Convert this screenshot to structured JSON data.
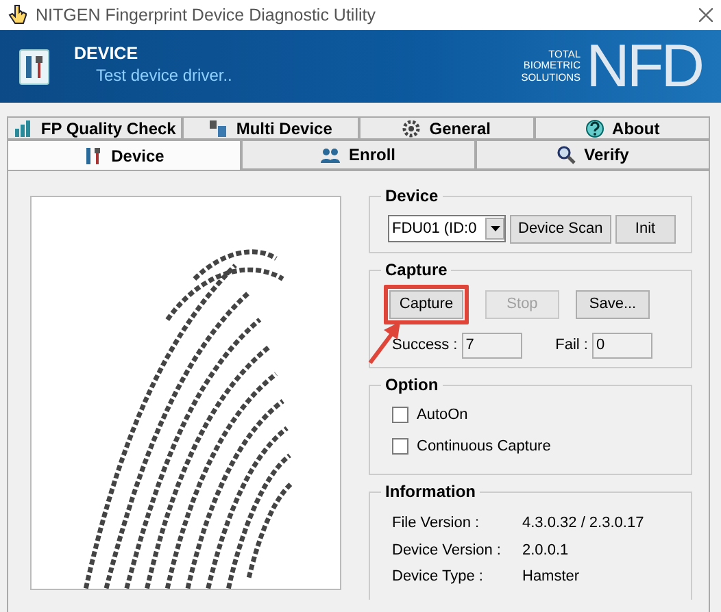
{
  "window": {
    "title": "NITGEN Fingerprint Device Diagnostic Utility"
  },
  "banner": {
    "title": "DEVICE",
    "subtitle": "Test device driver..",
    "tagline": [
      "TOTAL",
      "BIOMETRIC",
      "SOLUTIONS"
    ],
    "logo": "NFD"
  },
  "tabs_back_row": [
    {
      "label": "FP Quality Check",
      "kind": "chart",
      "selected": false
    },
    {
      "label": "Multi Device",
      "kind": "devices",
      "selected": false
    },
    {
      "label": "General",
      "kind": "gear",
      "selected": false
    },
    {
      "label": "About",
      "kind": "help",
      "selected": false
    }
  ],
  "tabs_front_row": [
    {
      "label": "Device",
      "kind": "tools",
      "selected": true
    },
    {
      "label": "Enroll",
      "kind": "people",
      "selected": false
    },
    {
      "label": "Verify",
      "kind": "search",
      "selected": false
    }
  ],
  "device_group": {
    "title": "Device",
    "device_select": "FDU01 (ID:0",
    "buttons": [
      {
        "label": "Device Scan",
        "disabled": false
      },
      {
        "label": "Init",
        "disabled": false
      }
    ]
  },
  "capture_group": {
    "title": "Capture",
    "buttons": [
      {
        "label": "Capture",
        "disabled": false,
        "highlighted": true
      },
      {
        "label": "Stop",
        "disabled": true,
        "highlighted": false
      },
      {
        "label": "Save...",
        "disabled": false,
        "highlighted": false
      }
    ],
    "success_label": "Success :",
    "success_value": "7",
    "fail_label": "Fail :",
    "fail_value": "0"
  },
  "option_group": {
    "title": "Option",
    "checkboxes": [
      {
        "label": "AutoOn",
        "checked": false
      },
      {
        "label": "Continuous Capture",
        "checked": false
      }
    ]
  },
  "information_group": {
    "title": "Information",
    "rows": [
      {
        "label": "File Version :",
        "value": "4.3.0.32 / 2.3.0.17"
      },
      {
        "label": "Device Version :",
        "value": "2.0.0.1"
      },
      {
        "label": "Device Type :",
        "value": "Hamster"
      }
    ]
  }
}
